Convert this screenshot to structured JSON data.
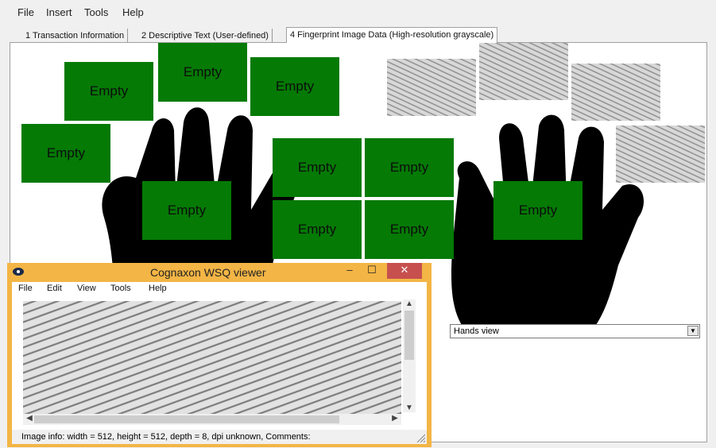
{
  "menubar": {
    "items": [
      "File",
      "Insert",
      "Tools",
      "Help"
    ]
  },
  "tabs": [
    {
      "label": "1 Transaction Information",
      "active": false
    },
    {
      "label": "2 Descriptive Text (User-defined)",
      "active": false
    },
    {
      "label": "4 Fingerprint Image Data (High-resolution grayscale)",
      "active": true
    }
  ],
  "left_hand": {
    "slots": [
      "Empty",
      "Empty",
      "Empty",
      "Empty",
      "Empty",
      "Empty",
      "Empty"
    ]
  },
  "right_hand": {
    "slots": [
      "Empty",
      "Empty",
      "Empty"
    ],
    "fingerprints_present": 4
  },
  "view_select": {
    "value": "Hands view"
  },
  "viewer": {
    "title": "Cognaxon WSQ viewer",
    "menus": [
      "File",
      "Edit",
      "View",
      "Tools",
      "Help"
    ],
    "status": "Image info: width = 512, height = 512, depth = 8, dpi unknown, Comments:"
  },
  "colors": {
    "slot_green": "#057a05",
    "viewer_frame": "#f3b545",
    "close_red": "#c7504f"
  }
}
